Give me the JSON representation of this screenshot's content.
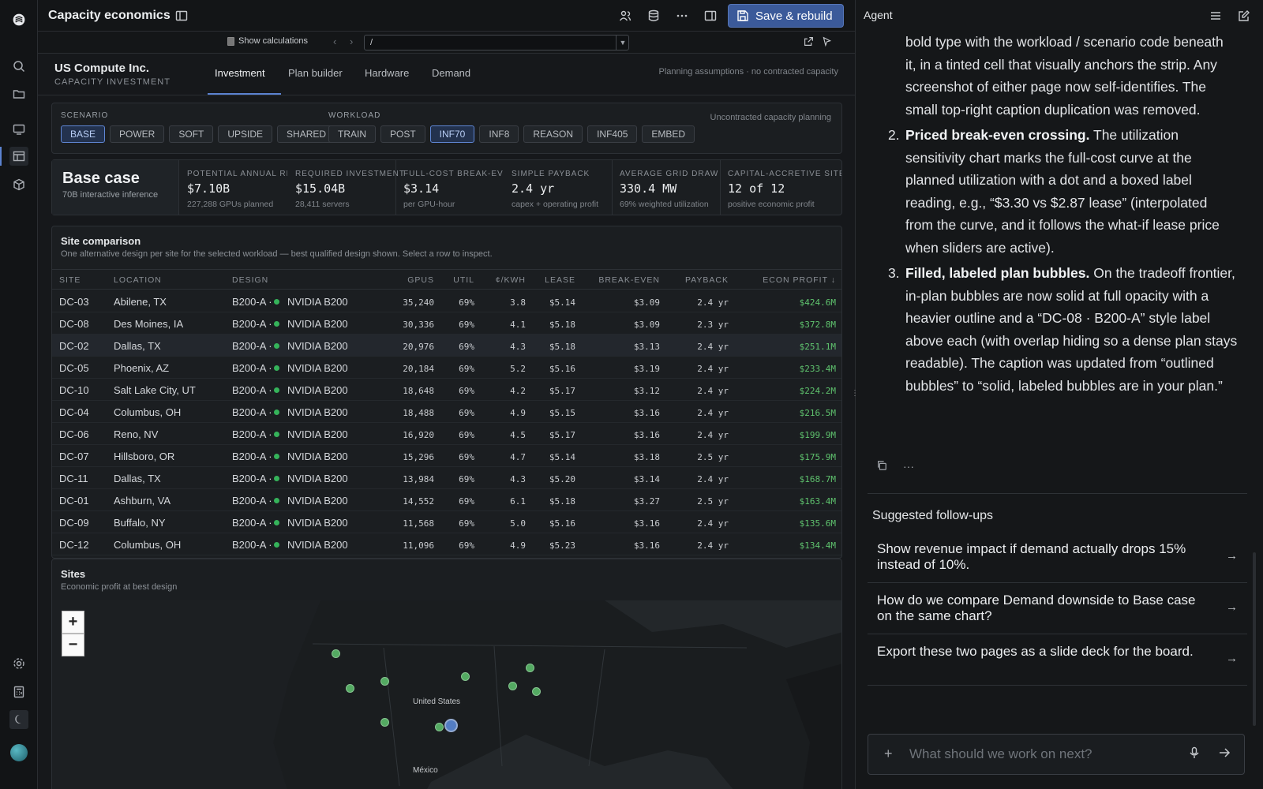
{
  "header": {
    "title": "Capacity economics",
    "save_label": "Save & rebuild",
    "show_calculations": "Show calculations",
    "formula_value": "/"
  },
  "company": {
    "name": "US Compute Inc.",
    "subtitle": "CAPACITY INVESTMENT"
  },
  "tabs": [
    {
      "label": "Investment",
      "active": true
    },
    {
      "label": "Plan builder",
      "active": false
    },
    {
      "label": "Hardware",
      "active": false
    },
    {
      "label": "Demand",
      "active": false
    }
  ],
  "assumptions_note": "Planning assumptions · no contracted capacity",
  "selectors": {
    "scenario_label": "SCENARIO",
    "scenarios": [
      "BASE",
      "POWER",
      "SOFT",
      "UPSIDE",
      "SHARED"
    ],
    "scenario_active": "BASE",
    "workload_label": "WORKLOAD",
    "workloads": [
      "TRAIN",
      "POST",
      "INF70",
      "INF8",
      "REASON",
      "INF405",
      "EMBED"
    ],
    "workload_active": "INF70",
    "note": "Uncontracted capacity planning"
  },
  "kpis": {
    "lead_title": "Base case",
    "lead_sub": "70B interactive inference",
    "items": [
      {
        "label": "POTENTIAL ANNUAL REVENUE",
        "value": "$7.10B",
        "sub": "227,288 GPUs planned"
      },
      {
        "label": "REQUIRED INVESTMENT",
        "value": "$15.04B",
        "sub": "28,411 servers"
      },
      {
        "label": "FULL-COST BREAK-EVEN",
        "value": "$3.14",
        "sub": "per GPU-hour"
      },
      {
        "label": "SIMPLE PAYBACK",
        "value": "2.4 yr",
        "sub": "capex + operating profit"
      },
      {
        "label": "AVERAGE GRID DRAW",
        "value": "330.4 MW",
        "sub": "69% weighted utilization"
      },
      {
        "label": "CAPITAL-ACCRETIVE SITES",
        "value": "12 of 12",
        "sub": "positive economic profit"
      }
    ]
  },
  "table": {
    "title": "Site comparison",
    "description": "One alternative design per site for the selected workload — best qualified design shown. Select a row to inspect.",
    "headers": {
      "site": "SITE",
      "location": "LOCATION",
      "design": "DESIGN",
      "gpus": "GPUS",
      "util": "UTIL",
      "ckwh": "¢/KWH",
      "lease": "LEASE",
      "breakeven": "BREAK-EVEN",
      "payback": "PAYBACK",
      "profit": "ECON PROFIT ↓"
    },
    "rows": [
      {
        "site": "DC-03",
        "location": "Abilene, TX",
        "design": "B200-A ·",
        "hw": "NVIDIA B200",
        "gpus": "35,240",
        "util": "69%",
        "ckwh": "3.8",
        "lease": "$5.14",
        "breakeven": "$3.09",
        "payback": "2.4 yr",
        "profit": "$424.6M"
      },
      {
        "site": "DC-08",
        "location": "Des Moines, IA",
        "design": "B200-A ·",
        "hw": "NVIDIA B200",
        "gpus": "30,336",
        "util": "69%",
        "ckwh": "4.1",
        "lease": "$5.18",
        "breakeven": "$3.09",
        "payback": "2.3 yr",
        "profit": "$372.8M"
      },
      {
        "site": "DC-02",
        "location": "Dallas, TX",
        "design": "B200-A ·",
        "hw": "NVIDIA B200",
        "gpus": "20,976",
        "util": "69%",
        "ckwh": "4.3",
        "lease": "$5.18",
        "breakeven": "$3.13",
        "payback": "2.4 yr",
        "profit": "$251.1M"
      },
      {
        "site": "DC-05",
        "location": "Phoenix, AZ",
        "design": "B200-A ·",
        "hw": "NVIDIA B200",
        "gpus": "20,184",
        "util": "69%",
        "ckwh": "5.2",
        "lease": "$5.16",
        "breakeven": "$3.19",
        "payback": "2.4 yr",
        "profit": "$233.4M"
      },
      {
        "site": "DC-10",
        "location": "Salt Lake City, UT",
        "design": "B200-A ·",
        "hw": "NVIDIA B200",
        "gpus": "18,648",
        "util": "69%",
        "ckwh": "4.2",
        "lease": "$5.17",
        "breakeven": "$3.12",
        "payback": "2.4 yr",
        "profit": "$224.2M"
      },
      {
        "site": "DC-04",
        "location": "Columbus, OH",
        "design": "B200-A ·",
        "hw": "NVIDIA B200",
        "gpus": "18,488",
        "util": "69%",
        "ckwh": "4.9",
        "lease": "$5.15",
        "breakeven": "$3.16",
        "payback": "2.4 yr",
        "profit": "$216.5M"
      },
      {
        "site": "DC-06",
        "location": "Reno, NV",
        "design": "B200-A ·",
        "hw": "NVIDIA B200",
        "gpus": "16,920",
        "util": "69%",
        "ckwh": "4.5",
        "lease": "$5.17",
        "breakeven": "$3.16",
        "payback": "2.4 yr",
        "profit": "$199.9M"
      },
      {
        "site": "DC-07",
        "location": "Hillsboro, OR",
        "design": "B200-A ·",
        "hw": "NVIDIA B200",
        "gpus": "15,296",
        "util": "69%",
        "ckwh": "4.7",
        "lease": "$5.14",
        "breakeven": "$3.18",
        "payback": "2.5 yr",
        "profit": "$175.9M"
      },
      {
        "site": "DC-11",
        "location": "Dallas, TX",
        "design": "B200-A ·",
        "hw": "NVIDIA B200",
        "gpus": "13,984",
        "util": "69%",
        "ckwh": "4.3",
        "lease": "$5.20",
        "breakeven": "$3.14",
        "payback": "2.4 yr",
        "profit": "$168.7M"
      },
      {
        "site": "DC-01",
        "location": "Ashburn, VA",
        "design": "B200-A ·",
        "hw": "NVIDIA B200",
        "gpus": "14,552",
        "util": "69%",
        "ckwh": "6.1",
        "lease": "$5.18",
        "breakeven": "$3.27",
        "payback": "2.5 yr",
        "profit": "$163.4M"
      },
      {
        "site": "DC-09",
        "location": "Buffalo, NY",
        "design": "B200-A ·",
        "hw": "NVIDIA B200",
        "gpus": "11,568",
        "util": "69%",
        "ckwh": "5.0",
        "lease": "$5.16",
        "breakeven": "$3.16",
        "payback": "2.4 yr",
        "profit": "$135.6M"
      },
      {
        "site": "DC-12",
        "location": "Columbus, OH",
        "design": "B200-A ·",
        "hw": "NVIDIA B200",
        "gpus": "11,096",
        "util": "69%",
        "ckwh": "4.9",
        "lease": "$5.23",
        "breakeven": "$3.16",
        "payback": "2.4 yr",
        "profit": "$134.4M"
      }
    ],
    "selected_site": "DC-02"
  },
  "map": {
    "title": "Sites",
    "subtitle": "Economic profit at best design",
    "zoom_in": "+",
    "zoom_out": "−",
    "labels": {
      "country": "United States",
      "mexico": "México"
    }
  },
  "agent": {
    "title": "Agent",
    "intro": "bold type with the workload / scenario code beneath it, in a tinted cell that visually anchors the strip. Any screenshot of either page now self-identifies. The small top-right caption duplication was removed.",
    "points": [
      {
        "num": "2.",
        "heading": "Priced break-even crossing.",
        "body": " The utilization sensitivity chart marks the full-cost curve at the planned utilization with a dot and a boxed label reading, e.g., “$3.30 vs $2.87 lease” (interpolated from the curve, and it follows the what-if lease price when sliders are active)."
      },
      {
        "num": "3.",
        "heading": "Filled, labeled plan bubbles.",
        "body": " On the tradeoff frontier, in-plan bubbles are now solid at full opacity with a heavier outline and a “DC-08 · B200-A” style label above each (with overlap hiding so a dense plan stays readable). The caption was updated from “outlined bubbles” to “solid, labeled bubbles are in your plan.”"
      }
    ],
    "more_label": "···",
    "followups_title": "Suggested follow-ups",
    "followups": [
      "Show revenue impact if demand actually drops 15% instead of 10%.",
      "How do we compare Demand downside to Base case on the same chart?",
      "Export these two pages as a slide deck for the board."
    ],
    "composer_placeholder": "What should we work on next?"
  },
  "colors": {
    "accent": "#5b82d0",
    "profit": "#5fc36e",
    "save_button": "#3b5a9a"
  }
}
